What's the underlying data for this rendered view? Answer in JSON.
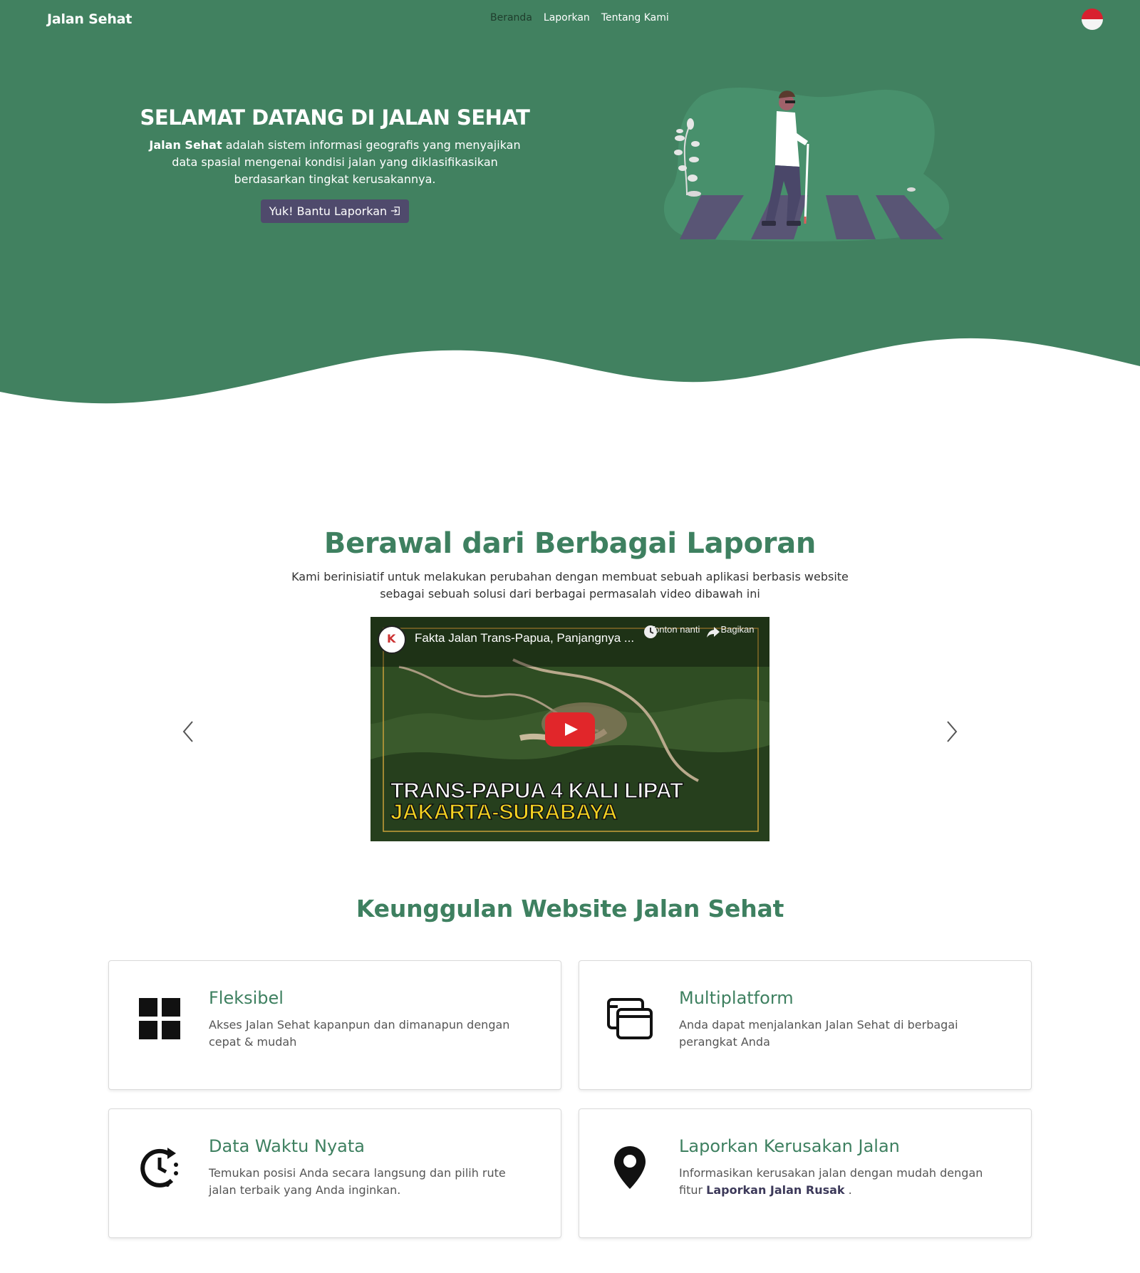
{
  "colors": {
    "hero_green": "#418160",
    "accent_green": "#3e8060",
    "button_purple": "#4f4a6c",
    "nav_active": "#1f3d2c"
  },
  "navbar": {
    "brand": "Jalan Sehat",
    "items": [
      {
        "label": "Beranda",
        "active": true
      },
      {
        "label": "Laporkan",
        "active": false
      },
      {
        "label": "Tentang Kami",
        "active": false
      }
    ],
    "language_icon": "indonesia-flag-icon"
  },
  "hero": {
    "title": "SELAMAT DATANG DI JALAN SEHAT",
    "desc_bold": "Jalan Sehat",
    "desc_rest": "adalah sistem informasi geografis yang menyajikan data spasial mengenai kondisi jalan yang diklasifikasikan berdasarkan tingkat kerusakannya.",
    "cta_label": "Yuk! Bantu Laporkan",
    "cta_icon": "login-icon"
  },
  "reports": {
    "title": "Berawal dari Berbagai Laporan",
    "desc": "Kami berinisiatif untuk melakukan perubahan dengan membuat sebuah aplikasi berbasis website sebagai sebuah solusi dari berbagai permasalah video dibawah ini",
    "video": {
      "title": "Fakta Jalan Trans-Papua, Panjangnya ...",
      "watch_later": "Tonton nanti",
      "share": "Bagikan",
      "caption_line1": "TRANS-PAPUA 4 KALI LIPAT",
      "caption_line2": "JAKARTA-SURABAYA",
      "watermark": "KOMPAS"
    },
    "prev_icon": "chevron-left-icon",
    "next_icon": "chevron-right-icon"
  },
  "features": {
    "title": "Keunggulan Website Jalan Sehat",
    "items": [
      {
        "title": "Fleksibel",
        "desc": "Akses Jalan Sehat kapanpun dan dimanapun dengan cepat & mudah",
        "icon": "grid-icon"
      },
      {
        "title": "Multiplatform",
        "desc": "Anda dapat menjalankan Jalan Sehat di berbagai perangkat Anda",
        "icon": "windows-icon"
      },
      {
        "title": "Data Waktu Nyata",
        "desc": "Temukan posisi Anda secara langsung dan pilih rute jalan terbaik yang Anda inginkan.",
        "icon": "clock-history-icon"
      },
      {
        "title": "Laporkan Kerusakan Jalan",
        "desc_prefix": "Informasikan kerusakan jalan dengan mudah dengan fitur",
        "desc_link": "Laporkan Jalan Rusak",
        "desc_suffix": ".",
        "icon": "map-pin-icon"
      }
    ]
  }
}
